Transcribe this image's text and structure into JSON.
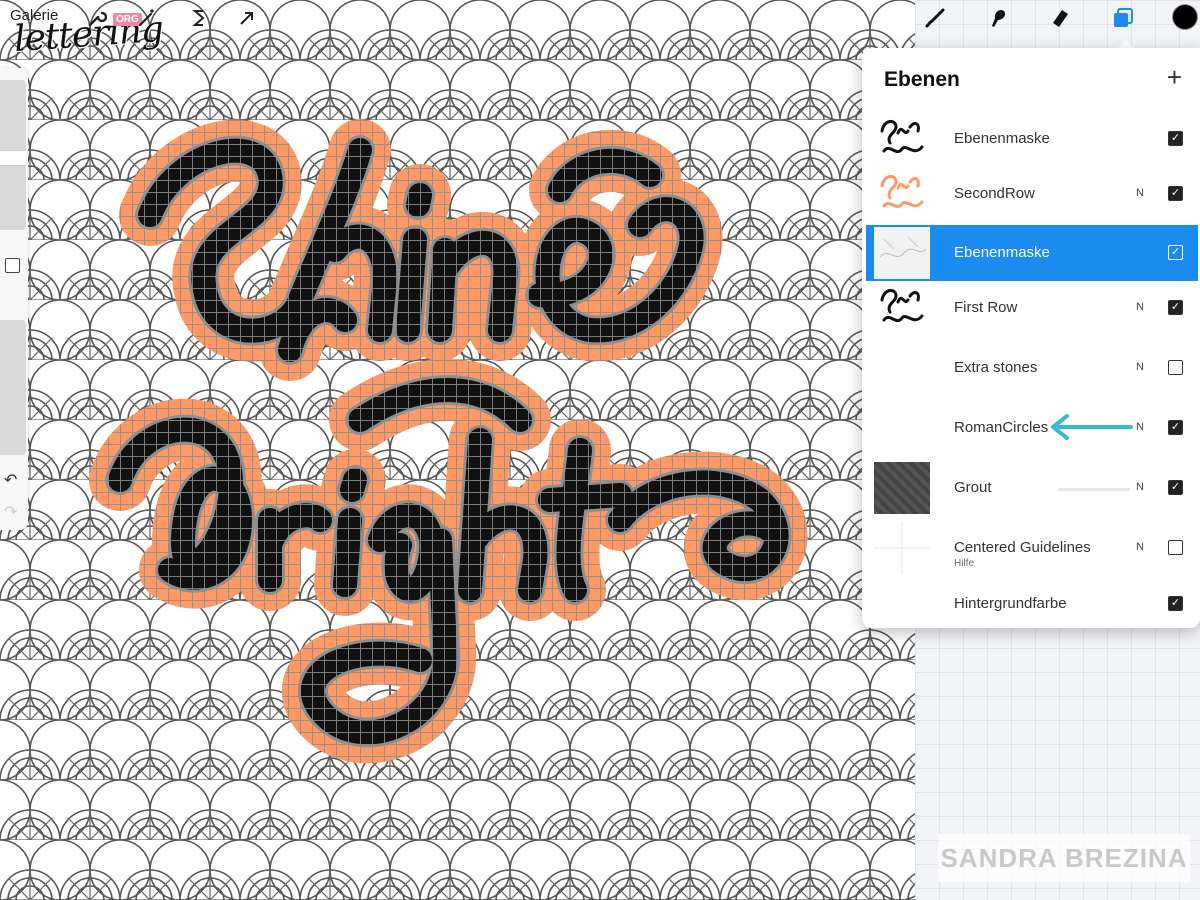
{
  "app": {
    "gallery_label": "Galerie",
    "logo_text": "lettering",
    "logo_badge": "ORG"
  },
  "artwork": {
    "line1": "Shine",
    "line2": "bright"
  },
  "toolbar": {
    "left_tools": [
      "wrench-icon",
      "magic-wand-icon",
      "adjust-s-icon",
      "arrow-cursor-icon"
    ],
    "right_tools": [
      "brush-icon",
      "smudge-icon",
      "eraser-icon",
      "layers-icon",
      "color-swatch"
    ],
    "active_tool": "layers-icon",
    "accent_color": "#1a8cf0",
    "current_color": "#000000"
  },
  "layers_panel": {
    "title": "Ebenen",
    "add_label": "+",
    "layers": [
      {
        "name": "Ebenenmaske",
        "sub": "",
        "blend": "",
        "visible": true,
        "selected": false
      },
      {
        "name": "SecondRow",
        "sub": "",
        "blend": "N",
        "visible": true,
        "selected": false
      },
      {
        "name": "Ebenenmaske",
        "sub": "",
        "blend": "",
        "visible": true,
        "selected": true
      },
      {
        "name": "First Row",
        "sub": "",
        "blend": "N",
        "visible": true,
        "selected": false
      },
      {
        "name": "Extra stones",
        "sub": "",
        "blend": "N",
        "visible": false,
        "selected": false
      },
      {
        "name": "RomanCircles",
        "sub": "",
        "blend": "N",
        "visible": true,
        "selected": false
      },
      {
        "name": "Grout",
        "sub": "",
        "blend": "N",
        "visible": true,
        "selected": false
      },
      {
        "name": "Centered Guidelines",
        "sub": "Hilfe",
        "blend": "N",
        "visible": false,
        "selected": false
      },
      {
        "name": "Hintergrundfarbe",
        "sub": "",
        "blend": "",
        "visible": true,
        "selected": false
      }
    ]
  },
  "colors": {
    "mosaic_orange": "#ff9a66",
    "mosaic_black": "#111111",
    "grout_gray": "#8a8a8a",
    "annotation_arrow": "#3ab8d0"
  },
  "watermark": "SANDRA BREZINA"
}
